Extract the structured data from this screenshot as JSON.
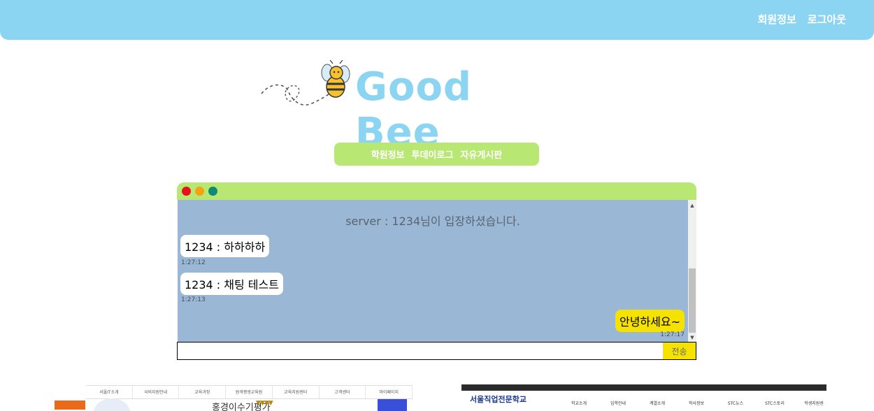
{
  "header": {
    "nav": [
      "회원정보",
      "로그아웃"
    ]
  },
  "logo": {
    "title": "Good Bee"
  },
  "menu": {
    "items": [
      "학원정보",
      "투데이로그",
      "자유게시판"
    ]
  },
  "chat": {
    "system_message": "server : 1234님이 입장하셨습니다.",
    "messages": [
      {
        "text": "1234 : 하하하하",
        "time": "1:27:12",
        "mine": false
      },
      {
        "text": "1234 : 채팅 테스트",
        "time": "1:27:13",
        "mine": false
      },
      {
        "text": "안녕하세요~",
        "time": "1:27:17",
        "mine": true
      }
    ],
    "input_value": "",
    "send_label": "전송"
  },
  "thumbnails": {
    "left": {
      "nav": [
        "서울IT소개",
        "국비지원안내",
        "교육과정",
        "원격평생교육원",
        "교육지원센터",
        "고객센터",
        "마이페이지"
      ],
      "caption": "홍경이수기평가"
    },
    "right": {
      "school": "서울직업전문학교",
      "menu": [
        "학교소개",
        "입학안내",
        "계열소개",
        "학사정보",
        "STC뉴스",
        "STC스토리",
        "학생지원센"
      ]
    }
  },
  "colors": {
    "header": "#8bd5f2",
    "accent_green": "#b9e774",
    "chat_bg": "#9ab8d5",
    "my_bubble": "#f5e200"
  }
}
